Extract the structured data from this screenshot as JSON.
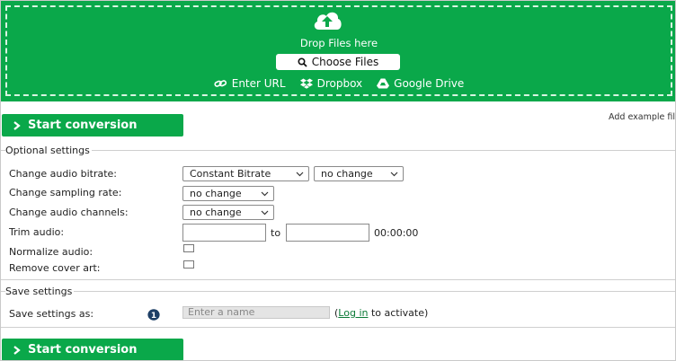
{
  "upload": {
    "drop_text": "Drop Files here",
    "choose_label": "Choose Files",
    "sources": [
      {
        "label": "Enter URL",
        "icon": "link-icon"
      },
      {
        "label": "Dropbox",
        "icon": "dropbox-icon"
      },
      {
        "label": "Google Drive",
        "icon": "google-drive-icon"
      }
    ]
  },
  "actions": {
    "start_label": "Start conversion",
    "example_link": "Add example fil"
  },
  "optional": {
    "title": "Optional settings",
    "bitrate_label": "Change audio bitrate:",
    "bitrate_mode": "Constant Bitrate",
    "bitrate_value": "no change",
    "sampling_label": "Change sampling rate:",
    "sampling_value": "no change",
    "channels_label": "Change audio channels:",
    "channels_value": "no change",
    "trim_label": "Trim audio:",
    "trim_to": "to",
    "trim_time": "00:00:00",
    "normalize_label": "Normalize audio:",
    "cover_label": "Remove cover art:"
  },
  "save": {
    "title": "Save settings",
    "label": "Save settings as:",
    "placeholder": "Enter a name",
    "open_paren": "(",
    "login_link": "Log in",
    "activate_text": " to activate)"
  },
  "colors": {
    "accent": "#0aa84a"
  }
}
